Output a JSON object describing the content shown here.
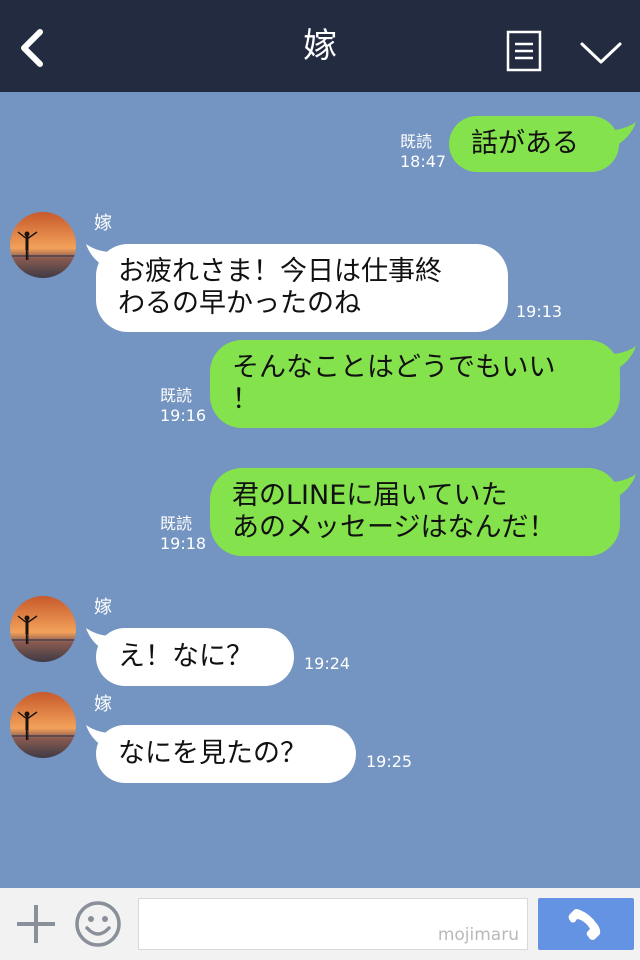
{
  "header": {
    "title": "嫁",
    "back_icon": "chevron-left-icon",
    "menu_icon": "document-menu-icon",
    "expand_icon": "chevron-down-icon"
  },
  "contact": {
    "name": "嫁"
  },
  "messages": [
    {
      "direction": "out",
      "lines": [
        "話がある"
      ],
      "read": "既読",
      "time": "18:47"
    },
    {
      "direction": "in",
      "lines": [
        "お疲れさま！今日は仕事終",
        "わるの早かったのね"
      ],
      "time": "19:13"
    },
    {
      "direction": "out",
      "lines": [
        "そんなことはどうでもいい",
        "！"
      ],
      "read": "既読",
      "time": "19:16"
    },
    {
      "direction": "out",
      "lines": [
        "君のLINEに届いていた",
        "あのメッセージはなんだ！"
      ],
      "read": "既読",
      "time": "19:18"
    },
    {
      "direction": "in",
      "lines": [
        "え！なに？"
      ],
      "time": "19:24"
    },
    {
      "direction": "in",
      "lines": [
        "なにを見たの？"
      ],
      "time": "19:25"
    }
  ],
  "footer": {
    "watermark": "mojimaru",
    "plus_icon": "plus-icon",
    "emoji_icon": "smiley-icon",
    "call_icon": "phone-icon"
  },
  "colors": {
    "header": "#222b40",
    "background": "#7494c1",
    "outgoing": "#84e24c",
    "incoming": "#ffffff",
    "call_button": "#6593e3"
  }
}
